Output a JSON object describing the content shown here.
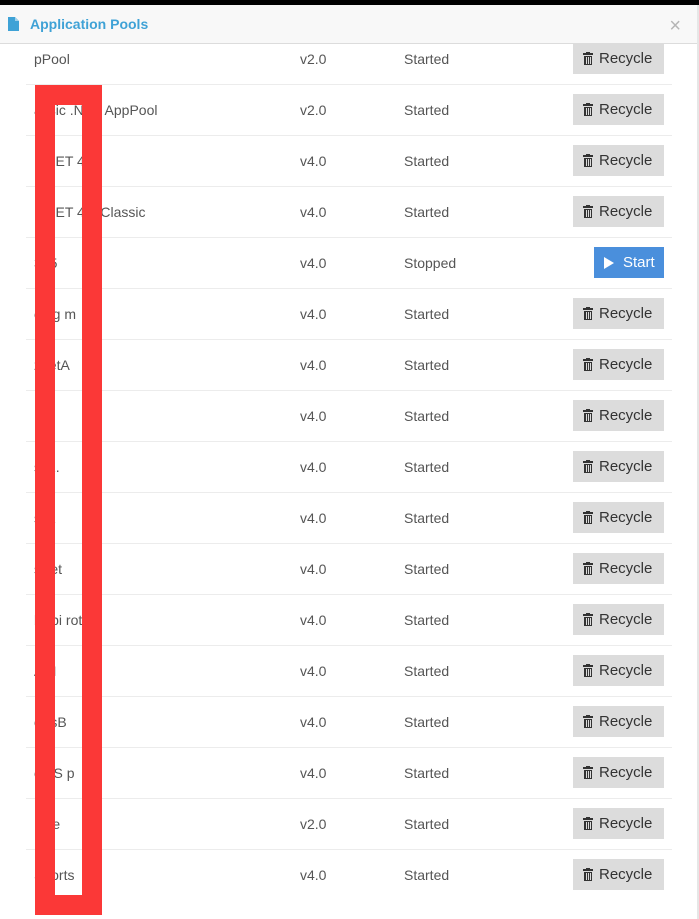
{
  "dialog": {
    "title": "Application Pools",
    "title_icon": "file-icon",
    "close_label": "×",
    "accent_color": "#3fa2d6"
  },
  "buttons": {
    "recycle_label": "Recycle",
    "start_label": "Start",
    "recycle_icon": "trash-icon",
    "start_icon": "play-icon",
    "start_color": "#4a8fdc",
    "recycle_color": "#dcdcdc"
  },
  "redaction": {
    "color": "#fb3837",
    "note": "first column partially obscured by red redaction box"
  },
  "pools": [
    {
      "name": "pPool",
      "version": "v2.0",
      "status": "Started",
      "action": "Recycle"
    },
    {
      "name": "assic .NET AppPool",
      "version": "v2.0",
      "status": "Started",
      "action": "Recycle"
    },
    {
      "name": "P.NET 4.0",
      "version": "v4.0",
      "status": "Started",
      "action": "Recycle"
    },
    {
      "name": "P.NET 4.0 Classic",
      "version": "v4.0",
      "status": "Started",
      "action": "Recycle"
    },
    {
      "name": "365",
      "version": "v4.0",
      "status": "Stopped",
      "action": "Start"
    },
    {
      "name": "eing m",
      "version": "v4.0",
      "status": "Started",
      "action": "Recycle"
    },
    {
      "name": "zbetA",
      "version": "v4.0",
      "status": "Started",
      "action": "Recycle"
    },
    {
      "name": "",
      "version": "v4.0",
      "status": "Started",
      "action": "Recycle"
    },
    {
      "name": "sv2.",
      "version": "v4.0",
      "status": "Started",
      "action": "Recycle"
    },
    {
      "name": "sv2",
      "version": "v4.0",
      "status": "Started",
      "action": "Recycle"
    },
    {
      "name": "sBet",
      "version": "v4.0",
      "status": "Started",
      "action": "Recycle"
    },
    {
      "name": "bApi rottle",
      "version": "v4.0",
      "status": "Started",
      "action": "Recycle"
    },
    {
      "name": "API",
      "version": "v4.0",
      "status": "Started",
      "action": "Recycle"
    },
    {
      "name": "ortsB",
      "version": "v4.0",
      "status": "Started",
      "action": "Recycle"
    },
    {
      "name": "eetS p",
      "version": "v4.0",
      "status": "Started",
      "action": "Recycle"
    },
    {
      "name": "P.Te",
      "version": "v2.0",
      "status": "Started",
      "action": "Recycle"
    },
    {
      "name": "Sports",
      "version": "v4.0",
      "status": "Started",
      "action": "Recycle"
    }
  ]
}
